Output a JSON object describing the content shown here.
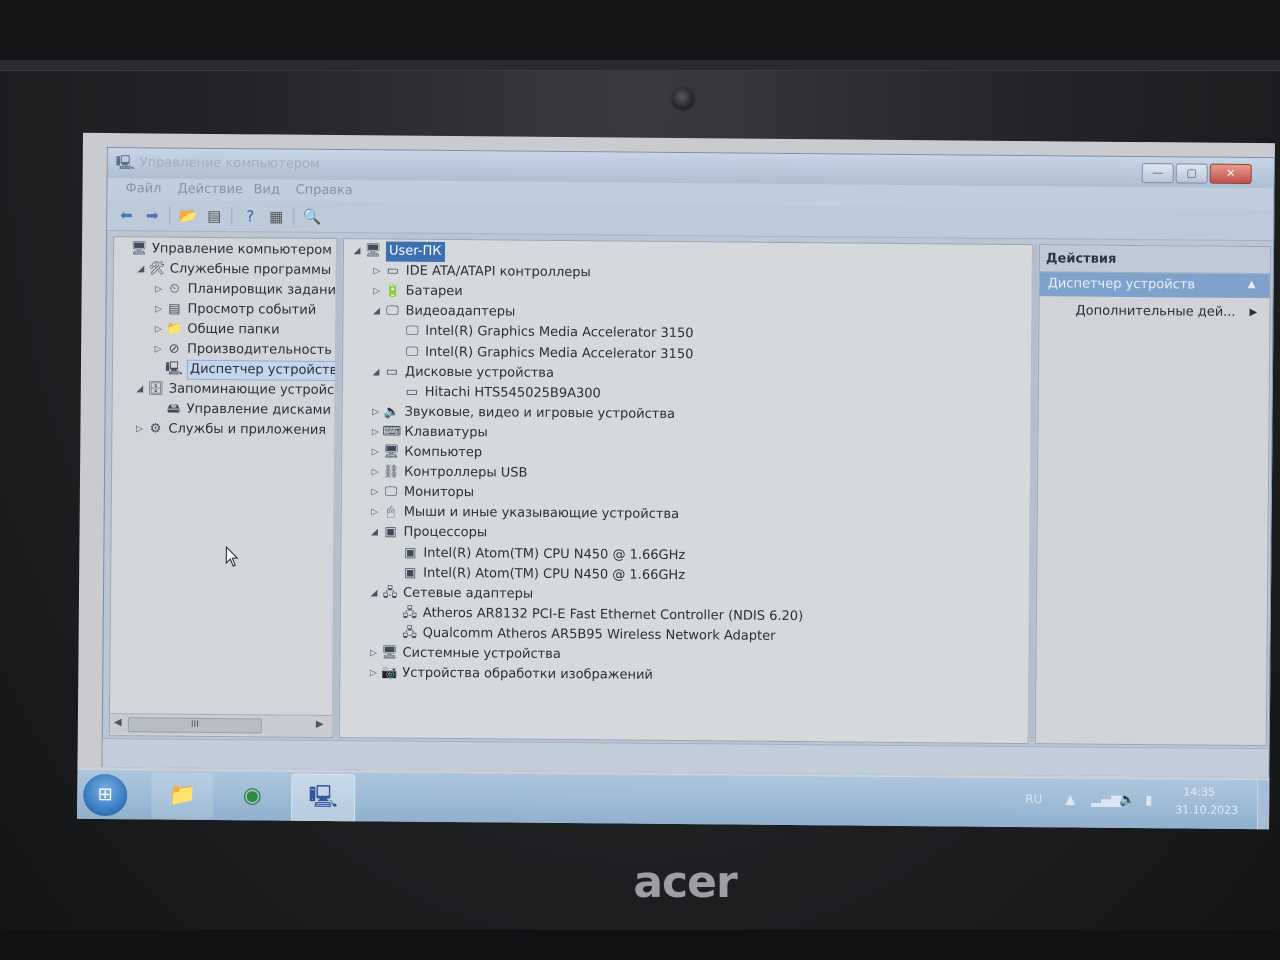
{
  "device": {
    "brand": "acer"
  },
  "window": {
    "title": "Управление компьютером",
    "controls": {
      "minimize": "—",
      "maximize": "▢",
      "close": "✕"
    }
  },
  "menu": [
    "Файл",
    "Действие",
    "Вид",
    "Справка"
  ],
  "left_tree": [
    {
      "label": "Управление компьютером (л",
      "arrow": "",
      "icon": "computer-mgmt-icon",
      "glyph": "🖥",
      "level": 0
    },
    {
      "label": "Служебные программы",
      "arrow": "◢",
      "icon": "tools-icon",
      "glyph": "🛠",
      "level": 1
    },
    {
      "label": "Планировщик заданий",
      "arrow": "▷",
      "icon": "scheduler-icon",
      "glyph": "⏲",
      "level": 2
    },
    {
      "label": "Просмотр событий",
      "arrow": "▷",
      "icon": "event-viewer-icon",
      "glyph": "▤",
      "level": 2
    },
    {
      "label": "Общие папки",
      "arrow": "▷",
      "icon": "shared-folder-icon",
      "glyph": "📁",
      "level": 2
    },
    {
      "label": "Производительность",
      "arrow": "▷",
      "icon": "performance-icon",
      "glyph": "⊘",
      "level": 2
    },
    {
      "label": "Диспетчер устройств",
      "arrow": "",
      "icon": "device-manager-icon",
      "glyph": "🖳",
      "level": 2,
      "selected": true
    },
    {
      "label": "Запоминающие устройст",
      "arrow": "◢",
      "icon": "storage-icon",
      "glyph": "🗄",
      "level": 1
    },
    {
      "label": "Управление дисками",
      "arrow": "",
      "icon": "disk-mgmt-icon",
      "glyph": "🖴",
      "level": 2
    },
    {
      "label": "Службы и приложения",
      "arrow": "▷",
      "icon": "services-icon",
      "glyph": "⚙",
      "level": 1
    }
  ],
  "device_tree": [
    {
      "label": "User-ПК",
      "arrow": "◢",
      "glyph": "🖥",
      "icon": "computer-icon",
      "level": 0,
      "highlight": true
    },
    {
      "label": "IDE ATA/ATAPI контроллеры",
      "arrow": "▷",
      "glyph": "▭",
      "icon": "ide-controller-icon",
      "level": 1
    },
    {
      "label": "Батареи",
      "arrow": "▷",
      "glyph": "🔋",
      "icon": "battery-icon",
      "level": 1
    },
    {
      "label": "Видеоадаптеры",
      "arrow": "◢",
      "glyph": "🖵",
      "icon": "display-adapter-icon",
      "level": 1
    },
    {
      "label": "Intel(R) Graphics Media Accelerator 3150",
      "arrow": "",
      "glyph": "🖵",
      "icon": "display-adapter-icon",
      "level": 2
    },
    {
      "label": "Intel(R) Graphics Media Accelerator 3150",
      "arrow": "",
      "glyph": "🖵",
      "icon": "display-adapter-icon",
      "level": 2
    },
    {
      "label": "Дисковые устройства",
      "arrow": "◢",
      "glyph": "▭",
      "icon": "disk-drive-icon",
      "level": 1
    },
    {
      "label": "Hitachi HTS545025B9A300",
      "arrow": "",
      "glyph": "▭",
      "icon": "disk-drive-icon",
      "level": 2
    },
    {
      "label": "Звуковые, видео и игровые устройства",
      "arrow": "▷",
      "glyph": "🔈",
      "icon": "sound-icon",
      "level": 1
    },
    {
      "label": "Клавиатуры",
      "arrow": "▷",
      "glyph": "⌨",
      "icon": "keyboard-icon",
      "level": 1
    },
    {
      "label": "Компьютер",
      "arrow": "▷",
      "glyph": "🖥",
      "icon": "computer-icon",
      "level": 1
    },
    {
      "label": "Контроллеры USB",
      "arrow": "▷",
      "glyph": "⛓",
      "icon": "usb-icon",
      "level": 1
    },
    {
      "label": "Мониторы",
      "arrow": "▷",
      "glyph": "🖵",
      "icon": "monitor-icon",
      "level": 1
    },
    {
      "label": "Мыши и иные указывающие устройства",
      "arrow": "▷",
      "glyph": "🖱",
      "icon": "mouse-icon",
      "level": 1
    },
    {
      "label": "Процессоры",
      "arrow": "◢",
      "glyph": "▣",
      "icon": "processor-icon",
      "level": 1
    },
    {
      "label": "Intel(R) Atom(TM) CPU N450   @ 1.66GHz",
      "arrow": "",
      "glyph": "▣",
      "icon": "processor-icon",
      "level": 2
    },
    {
      "label": "Intel(R) Atom(TM) CPU N450   @ 1.66GHz",
      "arrow": "",
      "glyph": "▣",
      "icon": "processor-icon",
      "level": 2
    },
    {
      "label": "Сетевые адаптеры",
      "arrow": "◢",
      "glyph": "🖧",
      "icon": "network-adapter-icon",
      "level": 1
    },
    {
      "label": "Atheros AR8132 PCI-E Fast Ethernet Controller (NDIS 6.20)",
      "arrow": "",
      "glyph": "🖧",
      "icon": "network-adapter-icon",
      "level": 2
    },
    {
      "label": "Qualcomm Atheros AR5B95 Wireless Network Adapter",
      "arrow": "",
      "glyph": "🖧",
      "icon": "network-adapter-icon",
      "level": 2
    },
    {
      "label": "Системные устройства",
      "arrow": "▷",
      "glyph": "🖥",
      "icon": "system-devices-icon",
      "level": 1
    },
    {
      "label": "Устройства обработки изображений",
      "arrow": "▷",
      "glyph": "📷",
      "icon": "imaging-icon",
      "level": 1
    }
  ],
  "actions": {
    "header": "Действия",
    "section": "Диспетчер устройств",
    "item": "Дополнительные дей..."
  },
  "scrollbar_grip": "III",
  "taskbar": {
    "language": "RU",
    "time": "14:35",
    "date": "31.10.2023"
  },
  "colors": {
    "selection": "#3e6fb1",
    "taskbar": "#8fb0cf"
  }
}
